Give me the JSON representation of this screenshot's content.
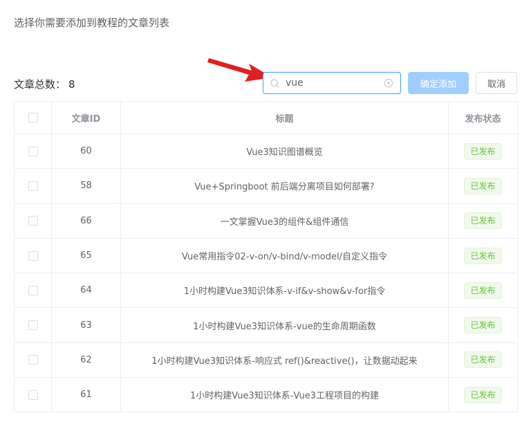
{
  "dialog": {
    "title": "选择你需要添加到教程的文章列表"
  },
  "count": {
    "label": "文章总数：",
    "value": "8"
  },
  "search": {
    "value": "vue"
  },
  "buttons": {
    "confirm": "确定添加",
    "cancel": "取消"
  },
  "colors": {
    "accent": "#409eff",
    "arrow": "#e02020",
    "tag_green": "#67c23a"
  },
  "table": {
    "headers": {
      "id": "文章ID",
      "title": "标题",
      "status": "发布状态"
    },
    "rows": [
      {
        "id": "60",
        "title": "Vue3知识图谱概览",
        "status": "已发布"
      },
      {
        "id": "58",
        "title": "Vue+Springboot 前后端分离项目如何部署?",
        "status": "已发布"
      },
      {
        "id": "66",
        "title": "一文掌握Vue3的组件&组件通信",
        "status": "已发布"
      },
      {
        "id": "65",
        "title": "Vue常用指令02-v-on/v-bind/v-model/自定义指令",
        "status": "已发布"
      },
      {
        "id": "64",
        "title": "1小时构建Vue3知识体系-v-if&v-show&v-for指令",
        "status": "已发布"
      },
      {
        "id": "63",
        "title": "1小时构建Vue3知识体系-vue的生命周期函数",
        "status": "已发布"
      },
      {
        "id": "62",
        "title": "1小时构建Vue3知识体系-响应式 ref()&reactive()，让数据动起来",
        "status": "已发布"
      },
      {
        "id": "61",
        "title": "1小时构建Vue3知识体系-Vue3工程项目的构建",
        "status": "已发布"
      }
    ]
  }
}
